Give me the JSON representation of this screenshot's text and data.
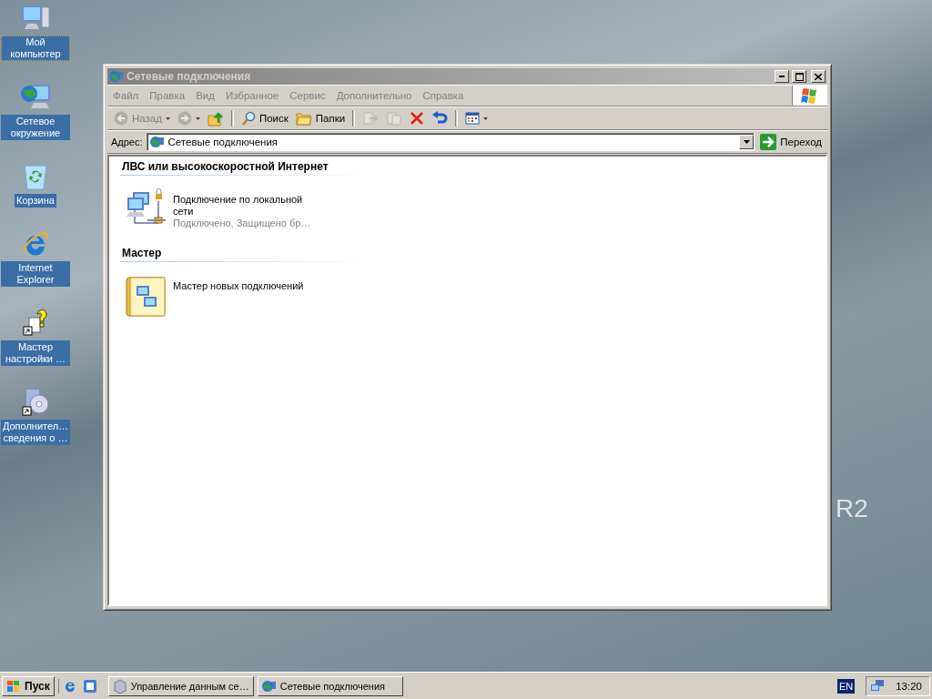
{
  "desktop_icons": [
    {
      "label": "Мой компьютер",
      "focused": true
    },
    {
      "label": "Сетевое окружение",
      "focused": false
    },
    {
      "label": "Корзина",
      "focused": false
    },
    {
      "label": "Internet Explorer",
      "focused": false
    },
    {
      "label": "Мастер настройки …",
      "focused": false
    },
    {
      "label": "Дополнител… сведения о …",
      "focused": false
    }
  ],
  "wallpaper_text": "R2",
  "window": {
    "title": "Сетевые подключения",
    "active": false,
    "menu": [
      "Файл",
      "Правка",
      "Вид",
      "Избранное",
      "Сервис",
      "Дополнительно",
      "Справка"
    ],
    "toolbar": [
      {
        "kind": "button",
        "label": "Назад",
        "disabled": true,
        "dropdown": true
      },
      {
        "kind": "button",
        "disabled": true,
        "dropdown": true
      },
      {
        "kind": "button",
        "disabled": false,
        "dropdown": false
      },
      {
        "kind": "separator"
      },
      {
        "kind": "button",
        "label": "Поиск",
        "disabled": false,
        "dropdown": false
      },
      {
        "kind": "button",
        "label": "Папки",
        "disabled": false,
        "dropdown": false
      },
      {
        "kind": "separator"
      },
      {
        "kind": "button",
        "disabled": true,
        "dropdown": false
      },
      {
        "kind": "button",
        "disabled": true,
        "dropdown": false
      },
      {
        "kind": "button",
        "disabled": false,
        "dropdown": false
      },
      {
        "kind": "button",
        "disabled": false,
        "dropdown": false
      },
      {
        "kind": "separator"
      },
      {
        "kind": "button",
        "disabled": false,
        "dropdown": true
      }
    ],
    "address": {
      "label": "Адрес:",
      "value": "Сетевые подключения",
      "go": "Переход"
    },
    "groups": [
      {
        "title": "ЛВС или высокоскоростной Интернет",
        "items": [
          {
            "name": "Подключение по локальной сети",
            "status": "Подключено, Защищено бр…"
          }
        ]
      },
      {
        "title": "Мастер",
        "items": [
          {
            "name": "Мастер новых подключений"
          }
        ]
      }
    ]
  },
  "taskbar": {
    "start": "Пуск",
    "tasks": [
      {
        "label": "Управление данным се…",
        "selected": false
      },
      {
        "label": "Сетевые подключения",
        "selected": false
      }
    ],
    "language": "EN",
    "clock": "13:20"
  }
}
